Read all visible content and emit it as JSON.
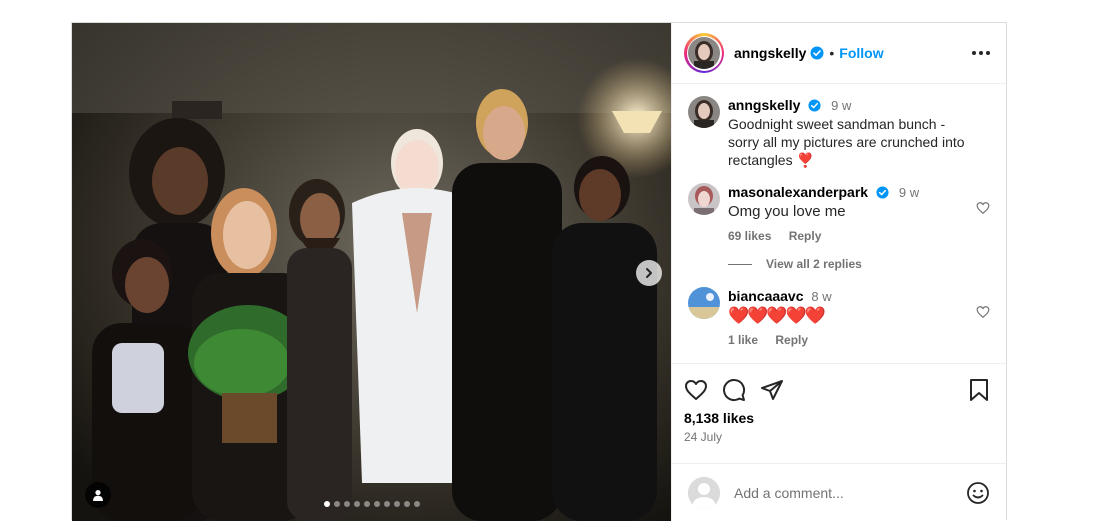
{
  "header": {
    "username": "anngskelly",
    "separator": "•",
    "follow_label": "Follow"
  },
  "caption": {
    "username": "anngskelly",
    "time": "9 w",
    "text": "Goodnight sweet sandman bunch - sorry all my pictures are crunched into rectangles ❣️"
  },
  "comments": [
    {
      "username": "masonalexanderpark",
      "time": "9 w",
      "text": "Omg you love me",
      "likes": "69 likes",
      "reply_label": "Reply",
      "view_replies": "View all 2 replies"
    },
    {
      "username": "biancaaavc",
      "time": "8 w",
      "text": "❤️❤️❤️❤️❤️",
      "likes": "1 like",
      "reply_label": "Reply"
    }
  ],
  "post": {
    "likes": "8,138 likes",
    "date": "24 July"
  },
  "add_comment": {
    "placeholder": "Add a comment..."
  },
  "carousel": {
    "slide_count": 10,
    "active_index": 0
  },
  "colors": {
    "accent": "#0095f6",
    "verified": "#0095f6",
    "text": "#262626",
    "secondary": "#737373",
    "heart_red": "#ed4956"
  }
}
